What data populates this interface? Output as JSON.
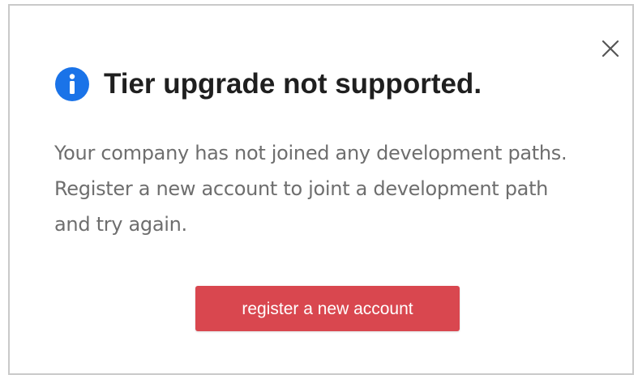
{
  "dialog": {
    "title": "Tier upgrade not supported.",
    "message": "Your company has not joined any development paths. Register a new account to joint a development path and try again.",
    "primary_button_label": "register a new account",
    "info_icon": "info-circle",
    "close_icon": "close-x"
  },
  "colors": {
    "info_icon": "#1a73e8",
    "primary_button": "#d9474f",
    "title_text": "#1f1f1f",
    "message_text": "#6e6e6e",
    "border": "#c9c9c9"
  }
}
